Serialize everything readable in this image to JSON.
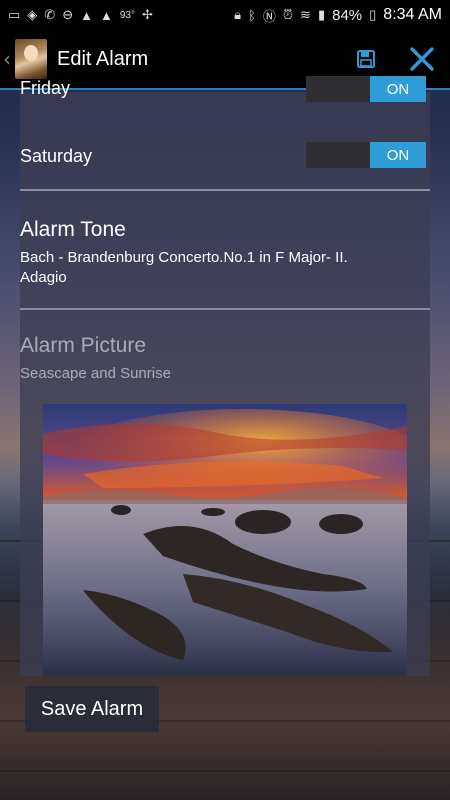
{
  "status_bar": {
    "temperature": "93°",
    "battery": "84%",
    "time": "8:34 AM"
  },
  "action_bar": {
    "title": "Edit Alarm",
    "save_icon": "floppy-disk-icon",
    "close_icon": "close-icon",
    "accent": "#2f9cd8"
  },
  "days": [
    {
      "label": "Friday",
      "toggle": "ON"
    },
    {
      "label": "Saturday",
      "toggle": "ON"
    }
  ],
  "alarm_tone": {
    "title": "Alarm Tone",
    "value_line1": "Bach - Brandenburg Concerto.No.1 in F Major- II.",
    "value_line2": "Adagio"
  },
  "alarm_picture": {
    "title": "Alarm Picture",
    "value": "Seascape and Sunrise"
  },
  "save_button": {
    "label": "Save Alarm"
  }
}
